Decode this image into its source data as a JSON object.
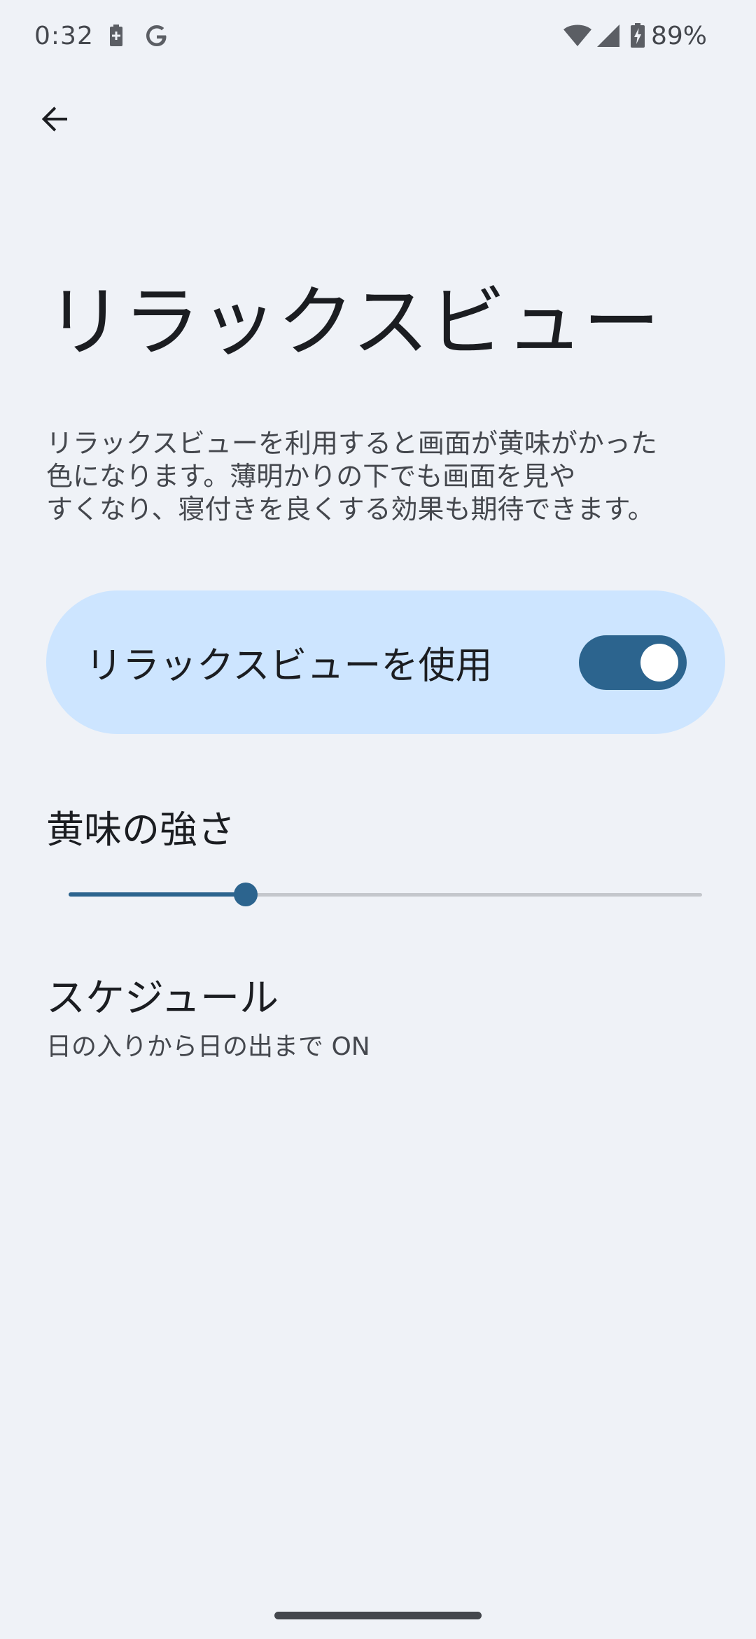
{
  "status_bar": {
    "time": "0:32",
    "battery_percent": "89%",
    "icons": [
      "battery-saver-icon",
      "google-icon",
      "wifi-icon",
      "cell-signal-icon",
      "battery-charging-icon"
    ]
  },
  "header": {
    "back_icon": "arrow-back-icon"
  },
  "page": {
    "title": "リラックスビュー",
    "description": "リラックスビューを利用すると画面が黄味がかった\n色になります。薄明かりの下でも画面を見や\nすくなり、寝付きを良くする効果も期待できます。"
  },
  "main_switch": {
    "label": "リラックスビューを使用",
    "checked": true
  },
  "intensity": {
    "label": "黄味の強さ",
    "value": 0.28
  },
  "schedule": {
    "title": "スケジュール",
    "summary": "日の入りから日の出まで ON"
  },
  "colors": {
    "background": "#eff2f7",
    "accent": "#2c648e",
    "card": "#cde5ff",
    "text_primary": "#1b1d21",
    "text_secondary": "#44474d",
    "track_inactive": "#c4c7cc"
  }
}
